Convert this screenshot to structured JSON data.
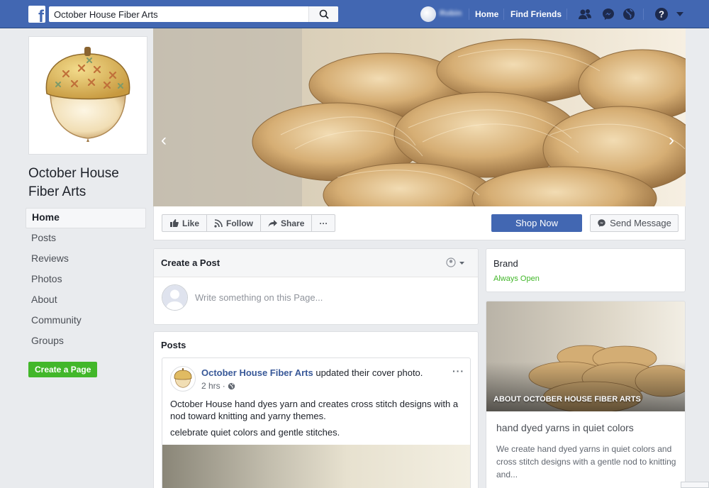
{
  "colors": {
    "brand_blue": "#4267b2",
    "page_bg": "#e9ebee",
    "link_blue": "#385898",
    "green": "#42b72a"
  },
  "topbar": {
    "search_value": "October House Fiber Arts",
    "user_name": "Robin",
    "home_label": "Home",
    "find_friends_label": "Find Friends",
    "icons": [
      "facebook-logo-icon",
      "search-icon",
      "friends-icon",
      "messenger-icon",
      "globe-icon",
      "help-icon",
      "caret-down-icon"
    ]
  },
  "sidebar": {
    "page_name": "October House Fiber Arts",
    "items": [
      {
        "label": "Home",
        "active": true
      },
      {
        "label": "Posts"
      },
      {
        "label": "Reviews"
      },
      {
        "label": "Photos"
      },
      {
        "label": "About"
      },
      {
        "label": "Community"
      },
      {
        "label": "Groups"
      }
    ],
    "create_page_label": "Create a Page"
  },
  "cover": {
    "slide_count": 4,
    "active_slide": 1
  },
  "actions": {
    "like": "Like",
    "follow": "Follow",
    "share": "Share",
    "more": "···",
    "shop_now": "Shop Now",
    "send_message": "Send Message"
  },
  "create_post": {
    "title": "Create a Post",
    "placeholder": "Write something on this Page..."
  },
  "posts": {
    "title": "Posts",
    "items": [
      {
        "author": "October House Fiber Arts",
        "action": "updated their cover photo.",
        "time": "2 hrs",
        "more": "···",
        "paragraphs": [
          "October House hand dyes yarn and creates cross stitch designs with a nod toward knitting and yarny themes.",
          "celebrate quiet colors and gentle stitches."
        ]
      }
    ]
  },
  "right": {
    "brand_label": "Brand",
    "status": "Always Open",
    "about_caption": "ABOUT OCTOBER HOUSE FIBER ARTS",
    "about_heading": "hand dyed yarns in quiet colors",
    "about_description": "We create hand dyed yarns in quiet colors and cross stitch designs with a gentle nod to knitting and..."
  }
}
